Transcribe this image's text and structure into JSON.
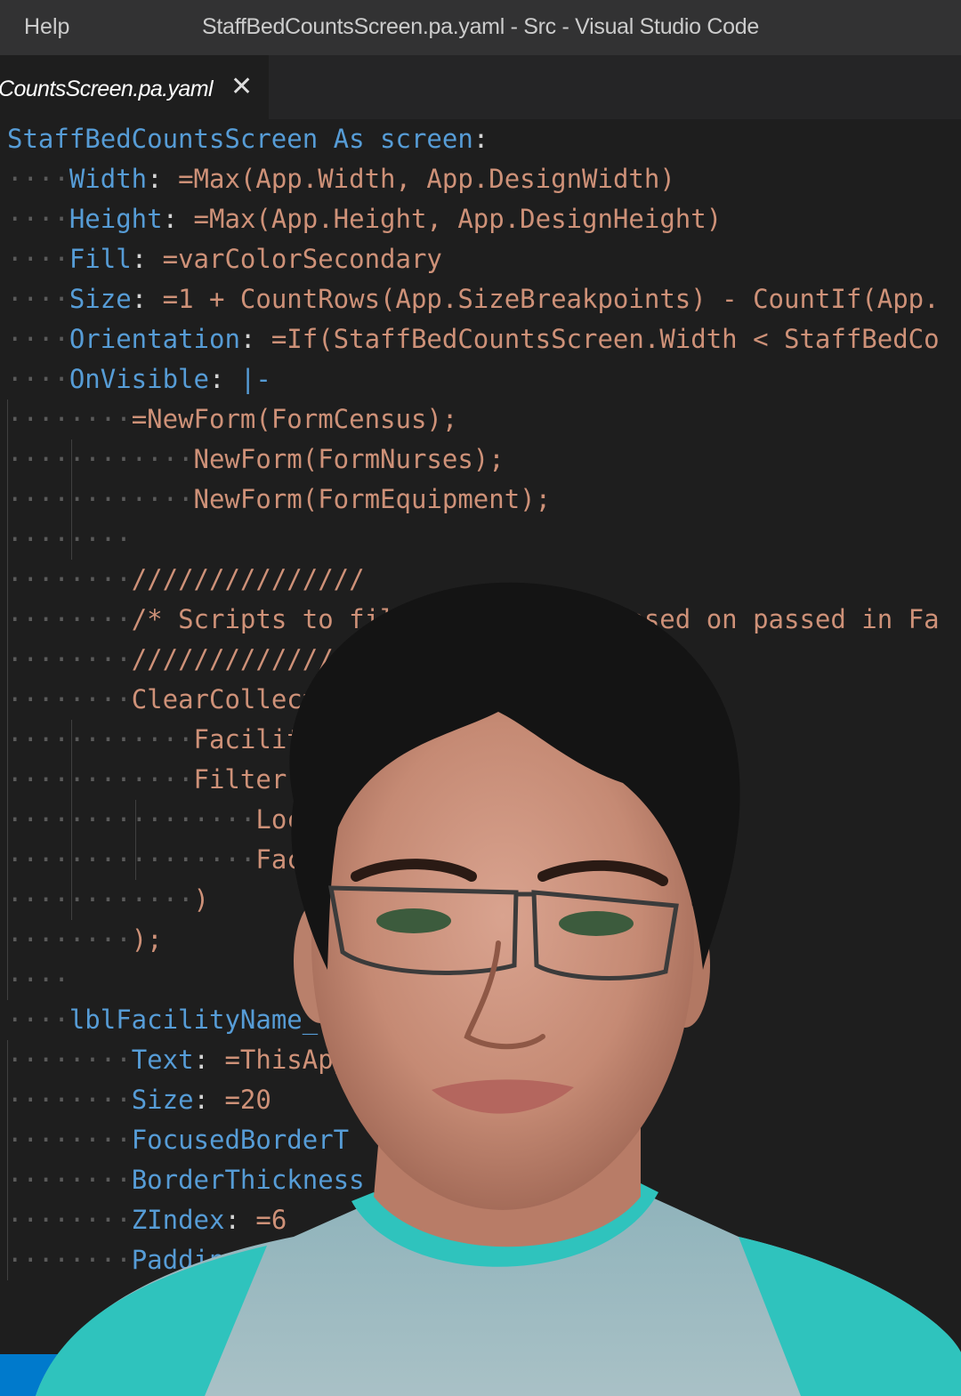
{
  "titlebar": {
    "menu_help": "Help",
    "window_title": "StaffBedCountsScreen.pa.yaml - Src - Visual Studio Code"
  },
  "tab": {
    "label": "CountsScreen.pa.yaml",
    "close_glyph": "✕"
  },
  "code_lines": [
    {
      "indent": 0,
      "parts": [
        {
          "t": "StaffBedCountsScreen As screen",
          "c": "key"
        },
        {
          "t": ":",
          "c": "plain"
        }
      ]
    },
    {
      "indent": 1,
      "parts": [
        {
          "t": "Width",
          "c": "key"
        },
        {
          "t": ": ",
          "c": "plain"
        },
        {
          "t": "=Max(App.Width, App.DesignWidth)",
          "c": "val"
        }
      ]
    },
    {
      "indent": 1,
      "parts": [
        {
          "t": "Height",
          "c": "key"
        },
        {
          "t": ": ",
          "c": "plain"
        },
        {
          "t": "=Max(App.Height, App.DesignHeight)",
          "c": "val"
        }
      ]
    },
    {
      "indent": 1,
      "parts": [
        {
          "t": "Fill",
          "c": "key"
        },
        {
          "t": ": ",
          "c": "plain"
        },
        {
          "t": "=varColorSecondary",
          "c": "val"
        }
      ]
    },
    {
      "indent": 1,
      "parts": [
        {
          "t": "Size",
          "c": "key"
        },
        {
          "t": ": ",
          "c": "plain"
        },
        {
          "t": "=1 + CountRows(App.SizeBreakpoints) - CountIf(App.",
          "c": "val"
        }
      ]
    },
    {
      "indent": 1,
      "parts": [
        {
          "t": "Orientation",
          "c": "key"
        },
        {
          "t": ": ",
          "c": "plain"
        },
        {
          "t": "=If(StaffBedCountsScreen.Width < StaffBedCo",
          "c": "val"
        }
      ]
    },
    {
      "indent": 1,
      "parts": [
        {
          "t": "OnVisible",
          "c": "key"
        },
        {
          "t": ": ",
          "c": "plain"
        },
        {
          "t": "|-",
          "c": "key"
        }
      ]
    },
    {
      "indent": 2,
      "parts": [
        {
          "t": "=NewForm(FormCensus);",
          "c": "val"
        }
      ]
    },
    {
      "indent": 3,
      "parts": [
        {
          "t": "NewForm(FormNurses);",
          "c": "val"
        }
      ]
    },
    {
      "indent": 3,
      "parts": [
        {
          "t": "NewForm(FormEquipment);",
          "c": "val"
        }
      ]
    },
    {
      "indent": 2,
      "parts": []
    },
    {
      "indent": 2,
      "parts": [
        {
          "t": "///////////////",
          "c": "cmt"
        }
      ]
    },
    {
      "indent": 2,
      "parts": [
        {
          "t": "/* Scripts to filter locations based on passed in Fa",
          "c": "cmt"
        }
      ]
    },
    {
      "indent": 2,
      "parts": [
        {
          "t": "///////////////",
          "c": "cmt"
        }
      ]
    },
    {
      "indent": 2,
      "parts": [
        {
          "t": "ClearCollect(",
          "c": "val"
        }
      ]
    },
    {
      "indent": 3,
      "parts": [
        {
          "t": "Facilities,",
          "c": "val"
        }
      ]
    },
    {
      "indent": 3,
      "parts": [
        {
          "t": "Filter(",
          "c": "val"
        }
      ]
    },
    {
      "indent": 4,
      "parts": [
        {
          "t": "Locations,",
          "c": "val"
        }
      ]
    },
    {
      "indent": 4,
      "parts": [
        {
          "t": "FacilityID = Param(\"FacilityID",
          "c": "val"
        }
      ]
    },
    {
      "indent": 3,
      "parts": [
        {
          "t": ")",
          "c": "val"
        }
      ]
    },
    {
      "indent": 2,
      "parts": [
        {
          "t": ");",
          "c": "val"
        }
      ]
    },
    {
      "indent": 1,
      "parts": []
    },
    {
      "indent": 1,
      "parts": [
        {
          "t": "lblFacilityName_",
          "c": "key"
        }
      ]
    },
    {
      "indent": 2,
      "parts": [
        {
          "t": "Text",
          "c": "key"
        },
        {
          "t": ": ",
          "c": "plain"
        },
        {
          "t": "=ThisApp",
          "c": "val"
        }
      ]
    },
    {
      "indent": 2,
      "parts": [
        {
          "t": "Size",
          "c": "key"
        },
        {
          "t": ": ",
          "c": "plain"
        },
        {
          "t": "=20",
          "c": "val"
        }
      ]
    },
    {
      "indent": 2,
      "parts": [
        {
          "t": "FocusedBorderT",
          "c": "key"
        }
      ]
    },
    {
      "indent": 2,
      "parts": [
        {
          "t": "BorderThickness",
          "c": "key"
        }
      ]
    },
    {
      "indent": 2,
      "parts": [
        {
          "t": "ZIndex",
          "c": "key"
        },
        {
          "t": ": ",
          "c": "plain"
        },
        {
          "t": "=6",
          "c": "val"
        }
      ]
    },
    {
      "indent": 2,
      "parts": [
        {
          "t": "Padding",
          "c": "key"
        }
      ]
    }
  ],
  "icons": {
    "close": "close-icon"
  },
  "colors": {
    "editor_bg": "#1e1e1e",
    "titlebar_bg": "#323233",
    "tabstrip_bg": "#252526",
    "keyword": "#569cd6",
    "string": "#ce9178",
    "status_accent": "#007acc"
  }
}
